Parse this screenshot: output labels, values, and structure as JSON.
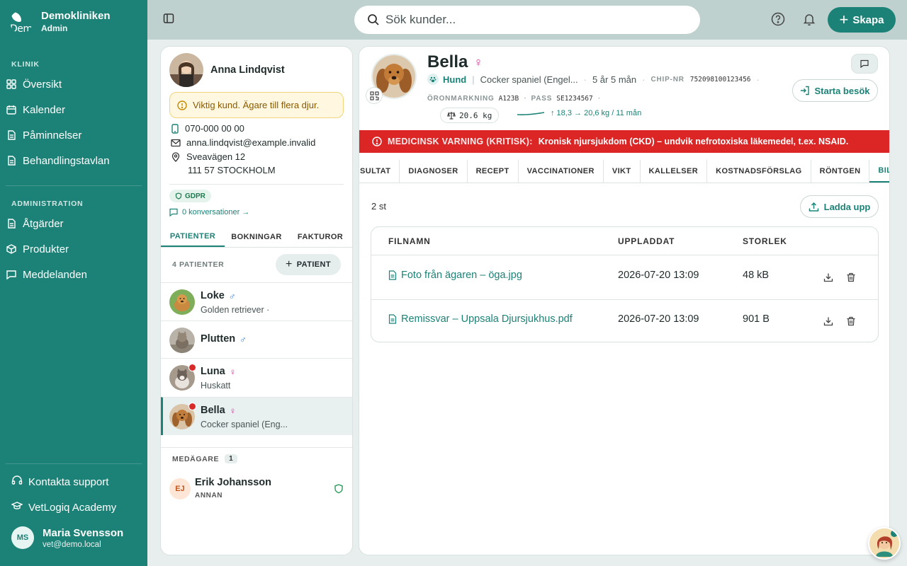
{
  "brand": {
    "name": "Demokliniken",
    "role": "Admin",
    "logo_text": "Dem"
  },
  "sidebar": {
    "section_clinic": "KLINIK",
    "clinic_items": [
      {
        "label": "Översikt",
        "icon": "grid-icon"
      },
      {
        "label": "Kalender",
        "icon": "calendar-icon"
      },
      {
        "label": "Påminnelser",
        "icon": "document-icon"
      },
      {
        "label": "Behandlingstavlan",
        "icon": "document-icon"
      }
    ],
    "section_admin": "ADMINISTRATION",
    "admin_items": [
      {
        "label": "Åtgärder",
        "icon": "document-icon"
      },
      {
        "label": "Produkter",
        "icon": "box-icon"
      },
      {
        "label": "Meddelanden",
        "icon": "message-icon"
      }
    ],
    "support": "Kontakta support",
    "academy": "VetLogiq Academy",
    "user": {
      "initials": "MS",
      "name": "Maria Svensson",
      "email": "vet@demo.local"
    }
  },
  "topbar": {
    "search_placeholder": "Sök kunder...",
    "create_label": "Skapa"
  },
  "owner": {
    "name": "Anna Lindqvist",
    "alert": "Viktig kund. Ägare till flera djur.",
    "phone": "070-000 00 00",
    "email": "anna.lindqvist@example.invalid",
    "address_line1": "Sveavägen 12",
    "address_line2": "111 57 STOCKHOLM",
    "gdpr": "GDPR",
    "conversations": "0 konversationer →"
  },
  "owner_tabs": {
    "patients": "PATIENTER",
    "bookings": "BOKNINGAR",
    "invoices": "FAKTUROR"
  },
  "patients_header": {
    "count": "4 PATIENTER",
    "add_label": "PATIENT"
  },
  "patients": [
    {
      "name": "Loke",
      "sex": "♂",
      "breed": "Golden retriever ·"
    },
    {
      "name": "Plutten",
      "sex": "♂",
      "breed": ""
    },
    {
      "name": "Luna",
      "sex": "♀",
      "breed": "Huskatt"
    },
    {
      "name": "Bella",
      "sex": "♀",
      "breed": "Cocker spaniel (Eng..."
    }
  ],
  "coowners": {
    "label": "MEDÄGARE",
    "count": "1",
    "items": [
      {
        "initials": "EJ",
        "name": "Erik Johansson",
        "role": "ANNAN"
      }
    ]
  },
  "pet": {
    "name": "Bella",
    "sex": "♀",
    "species": "Hund",
    "breed": "Cocker spaniel (Engel...",
    "age": "5 år 5 mån",
    "chip_label": "CHIP-NR",
    "chip": "752098100123456",
    "ear_label": "ÖRONMARKNING",
    "ear": "A123B",
    "pass_label": "PASS",
    "pass": "SE1234567",
    "weight": "20.6 kg",
    "trend": "↑ 18,3 → 20,6 kg / 11 mån",
    "visit_label": "Starta besök"
  },
  "warning": {
    "title": "MEDICINSK VARNING (KRITISK):",
    "text": "Kronisk njursjukdom (CKD) – undvik nefrotoxiska läkemedel, t.ex. NSAID."
  },
  "tabs": [
    "SULTAT",
    "DIAGNOSER",
    "RECEPT",
    "VACCINATIONER",
    "VIKT",
    "KALLELSER",
    "KOSTNADSFÖRSLAG",
    "RÖNTGEN",
    "BILAGOR"
  ],
  "attachments": {
    "count": "2 st",
    "upload_label": "Ladda upp",
    "columns": {
      "name": "FILNAMN",
      "uploaded": "UPPLADDAT",
      "size": "STORLEK"
    },
    "rows": [
      {
        "name": "Foto från ägaren – öga.jpg",
        "uploaded": "2026-07-20 13:09",
        "size": "48 kB"
      },
      {
        "name": "Remissvar – Uppsala Djursjukhus.pdf",
        "uploaded": "2026-07-20 13:09",
        "size": "901 B"
      }
    ]
  },
  "colors": {
    "primary": "#1c8277",
    "danger": "#dc2626",
    "topbar": "#bfd1ce"
  }
}
